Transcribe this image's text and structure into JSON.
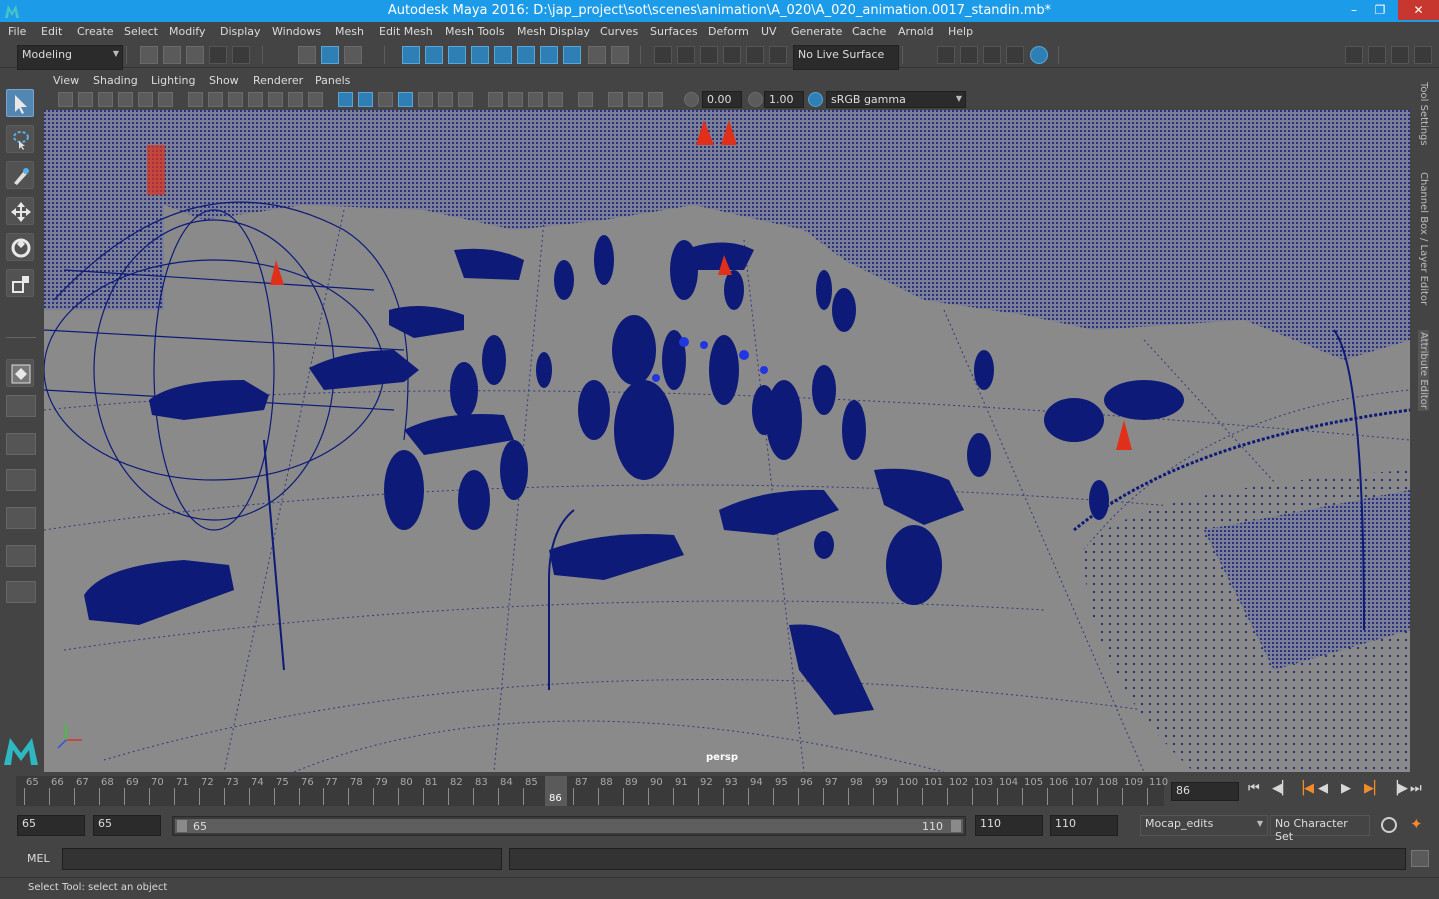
{
  "window": {
    "title": "Autodesk Maya 2016: D:\\jap_project\\sot\\scenes\\animation\\A_020\\A_020_animation.0017_standin.mb*",
    "minimize": "–",
    "maximize": "❐",
    "close": "✕"
  },
  "menubar": {
    "items": [
      "File",
      "Edit",
      "Create",
      "Select",
      "Modify",
      "Display",
      "Windows",
      "Mesh",
      "Edit Mesh",
      "Mesh Tools",
      "Mesh Display",
      "Curves",
      "Surfaces",
      "Deform",
      "UV",
      "Generate",
      "Cache",
      "Arnold",
      "Help"
    ]
  },
  "shelf": {
    "mode": "Modeling",
    "live_surface": "No Live Surface"
  },
  "panel": {
    "menus": [
      "View",
      "Shading",
      "Lighting",
      "Show",
      "Renderer",
      "Panels"
    ],
    "exposure": "0.00",
    "gamma": "1.00",
    "color_space": "sRGB gamma"
  },
  "viewport": {
    "camera": "persp"
  },
  "right_tabs": [
    "Tool Settings",
    "Channel Box / Layer Editor",
    "Attribute Editor"
  ],
  "timeline": {
    "ticks": [
      "65",
      "66",
      "67",
      "68",
      "69",
      "70",
      "71",
      "72",
      "73",
      "74",
      "75",
      "76",
      "77",
      "78",
      "79",
      "80",
      "81",
      "82",
      "83",
      "84",
      "85",
      "86",
      "87",
      "88",
      "89",
      "90",
      "91",
      "92",
      "93",
      "94",
      "95",
      "96",
      "97",
      "98",
      "99",
      "100",
      "101",
      "102",
      "103",
      "104",
      "105",
      "106",
      "107",
      "108",
      "109",
      "110"
    ],
    "current_frame": "86",
    "current_field": "86"
  },
  "range": {
    "start_a": "65",
    "start_b": "65",
    "slider_start": "65",
    "slider_end": "110",
    "end_a": "110",
    "end_b": "110",
    "anim_layer": "Mocap_edits",
    "character_set": "No Character Set"
  },
  "commandline": {
    "label": "MEL"
  },
  "status": {
    "text": "Select Tool: select an object"
  },
  "colors": {
    "titlebar": "#1c9be8",
    "wireframe": "#0d1a78",
    "viewport_bg": "#8a8a8a",
    "accent_red": "#e0301a"
  }
}
